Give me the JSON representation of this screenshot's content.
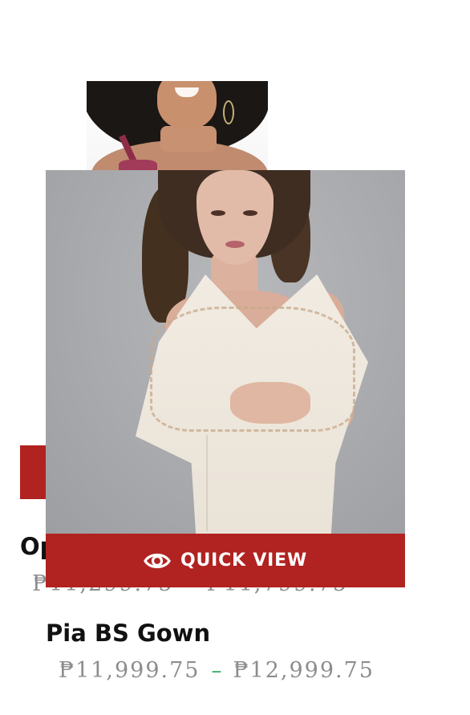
{
  "quick_view": {
    "label": "QUICK VIEW",
    "icon": "eye-icon",
    "background_color": "#b02320",
    "text_color": "#ffffff"
  },
  "products": [
    {
      "title": "Op",
      "price_min": "₱11,299.75",
      "price_separator": "–",
      "price_max": "₱11,799.75"
    },
    {
      "title": "Pia BS Gown",
      "price_min": "₱11,999.75",
      "price_separator": "–",
      "price_max": "₱12,999.75"
    }
  ],
  "colors": {
    "price_text": "#8d8d8d",
    "price_separator": "#27a85a",
    "title_text": "#111111"
  }
}
